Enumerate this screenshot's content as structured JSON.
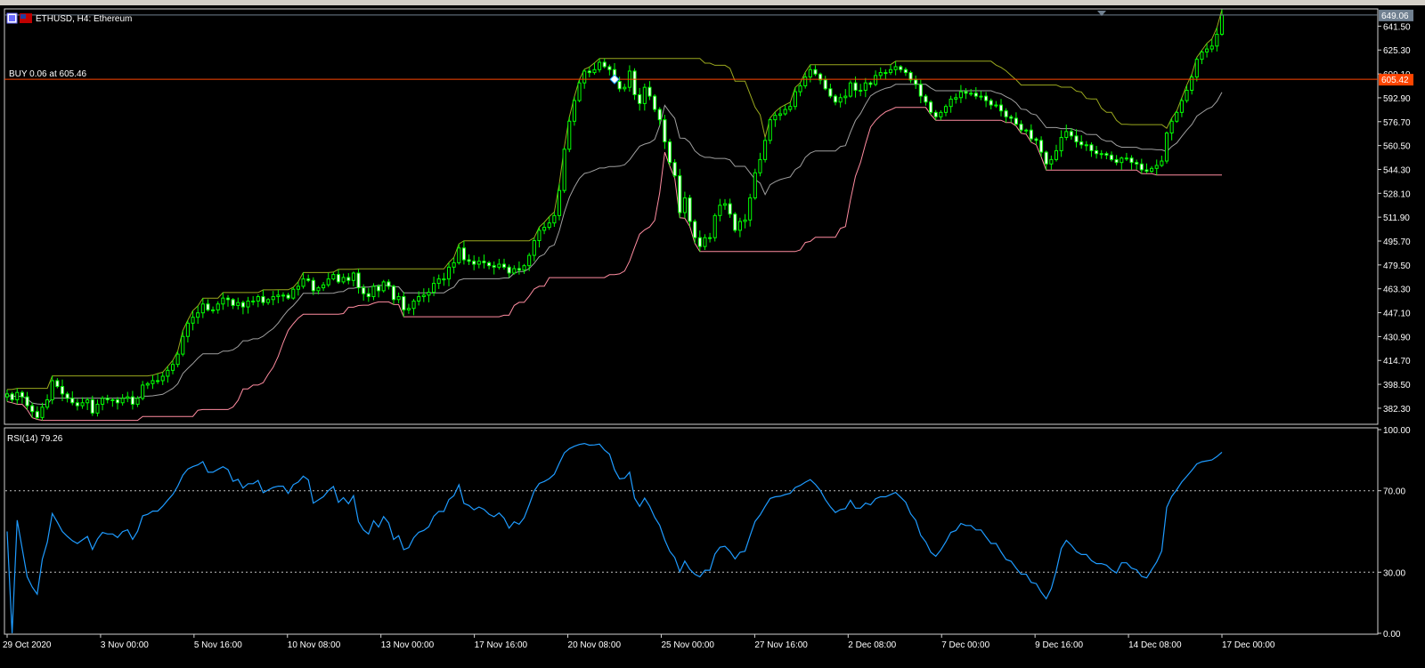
{
  "symbol_title": "ETHUSD, H4:  Ethereum",
  "order_label": "BUY 0.06 at 605.46",
  "price_badge_top": "649.06",
  "price_badge_order": "605.42",
  "rsi_label": "RSI(14) 79.26",
  "price_axis_ticks": [
    "641.50",
    "625.30",
    "609.10",
    "592.90",
    "576.70",
    "560.50",
    "544.30",
    "528.10",
    "511.90",
    "495.70",
    "479.50",
    "463.30",
    "447.10",
    "430.90",
    "414.70",
    "398.50",
    "382.30"
  ],
  "rsi_axis_ticks": [
    "100.00",
    "70.00",
    "30.00",
    "0.00"
  ],
  "time_axis_ticks": [
    "29 Oct 2020",
    "3 Nov 00:00",
    "5 Nov 16:00",
    "10 Nov 08:00",
    "13 Nov 00:00",
    "17 Nov 16:00",
    "20 Nov 08:00",
    "25 Nov 00:00",
    "27 Nov 16:00",
    "2 Dec 08:00",
    "7 Dec 00:00",
    "9 Dec 16:00",
    "14 Dec 08:00",
    "17 Dec 00:00"
  ],
  "colors": {
    "background": "#000000",
    "bull_candle": "#00ff00",
    "bear_candle": "#ffffff",
    "upper_band": "#9aa81e",
    "middle_band": "#a0a0a0",
    "lower_band": "#ff8ca0",
    "order_line": "#ff4500",
    "rsi_line": "#1e9bff",
    "axis_text": "#ffffff"
  },
  "chart_data": {
    "type": "candlestick",
    "symbol": "ETHUSD",
    "timeframe": "H4",
    "ylim": [
      372,
      652
    ],
    "rsi_period": 14,
    "rsi_ylim": [
      0,
      100
    ],
    "rsi_levels": [
      30,
      70
    ],
    "order": {
      "side": "BUY",
      "volume": 0.06,
      "price": 605.46
    },
    "last_price": 649.06,
    "close": [
      392,
      388,
      393,
      390,
      384,
      380,
      376,
      383,
      388,
      401,
      397,
      392,
      389,
      386,
      384,
      386,
      388,
      379,
      385,
      389,
      388,
      388,
      386,
      389,
      390,
      385,
      389,
      398,
      399,
      401,
      401,
      404,
      408,
      412,
      419,
      431,
      440,
      444,
      447,
      453,
      449,
      449,
      453,
      457,
      456,
      452,
      454,
      451,
      455,
      455,
      458,
      454,
      456,
      458,
      459,
      459,
      457,
      463,
      465,
      470,
      469,
      462,
      464,
      466,
      470,
      473,
      468,
      471,
      469,
      474,
      464,
      460,
      458,
      465,
      462,
      468,
      465,
      456,
      458,
      449,
      450,
      455,
      458,
      459,
      461,
      467,
      470,
      470,
      478,
      481,
      491,
      483,
      482,
      480,
      482,
      481,
      479,
      478,
      480,
      478,
      474,
      477,
      476,
      479,
      486,
      496,
      503,
      505,
      508,
      513,
      530,
      558,
      577,
      591,
      603,
      611,
      610,
      612,
      617,
      614,
      612,
      604,
      599,
      600,
      611,
      595,
      589,
      600,
      594,
      585,
      578,
      563,
      549,
      540,
      515,
      525,
      509,
      498,
      492,
      498,
      498,
      513,
      520,
      521,
      514,
      503,
      509,
      510,
      525,
      542,
      551,
      564,
      578,
      581,
      582,
      585,
      587,
      597,
      601,
      607,
      612,
      609,
      605,
      599,
      594,
      590,
      593,
      594,
      603,
      598,
      598,
      603,
      602,
      608,
      610,
      610,
      612,
      614,
      612,
      610,
      605,
      602,
      594,
      590,
      583,
      580,
      583,
      587,
      592,
      593,
      597,
      596,
      596,
      594,
      594,
      591,
      588,
      588,
      584,
      580,
      579,
      575,
      571,
      571,
      565,
      564,
      556,
      548,
      551,
      557,
      566,
      570,
      567,
      563,
      561,
      561,
      557,
      555,
      555,
      554,
      551,
      549,
      552,
      552,
      549,
      548,
      544,
      543,
      545,
      547,
      550,
      569,
      577,
      583,
      591,
      598,
      607,
      619,
      624,
      626,
      628,
      636,
      649
    ]
  }
}
